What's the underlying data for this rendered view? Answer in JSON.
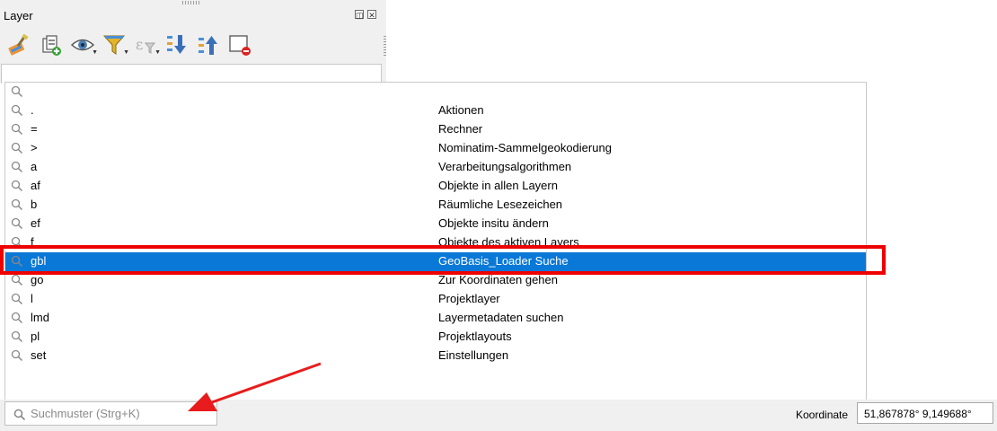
{
  "panel": {
    "title": "Layer",
    "float_glyph": "◫",
    "close_glyph": "✕",
    "toolbar_icons": [
      "paintbrush-style-icon",
      "add-group-icon",
      "eye-visibility-icon",
      "filter-legend-icon",
      "filter-expression-icon",
      "expand-all-icon",
      "collapse-all-icon",
      "remove-layer-icon"
    ]
  },
  "locator": {
    "rows": [
      {
        "prefix": "",
        "desc": ""
      },
      {
        "prefix": ".",
        "desc": "Aktionen"
      },
      {
        "prefix": "=",
        "desc": "Rechner"
      },
      {
        "prefix": ">",
        "desc": "Nominatim-Sammelgeokodierung"
      },
      {
        "prefix": "a",
        "desc": "Verarbeitungsalgorithmen"
      },
      {
        "prefix": "af",
        "desc": "Objekte in allen Layern"
      },
      {
        "prefix": "b",
        "desc": "Räumliche Lesezeichen"
      },
      {
        "prefix": "ef",
        "desc": "Objekte insitu ändern"
      },
      {
        "prefix": "f",
        "desc": "Objekte des aktiven Layers"
      },
      {
        "prefix": "gbl",
        "desc": "GeoBasis_Loader Suche"
      },
      {
        "prefix": "go",
        "desc": "Zur Koordinaten gehen"
      },
      {
        "prefix": "l",
        "desc": "Projektlayer"
      },
      {
        "prefix": "lmd",
        "desc": "Layermetadaten suchen"
      },
      {
        "prefix": "pl",
        "desc": "Projektlayouts"
      },
      {
        "prefix": "set",
        "desc": "Einstellungen"
      }
    ],
    "selected_index": 9
  },
  "statusbar": {
    "search_placeholder": "Suchmuster (Strg+K)",
    "coord_label": "Koordinate",
    "coord_value": "51,867878°  9,149688°"
  },
  "colors": {
    "selection": "#0a78d7",
    "highlight": "#ee0000",
    "arrow": "#e81c1c"
  }
}
